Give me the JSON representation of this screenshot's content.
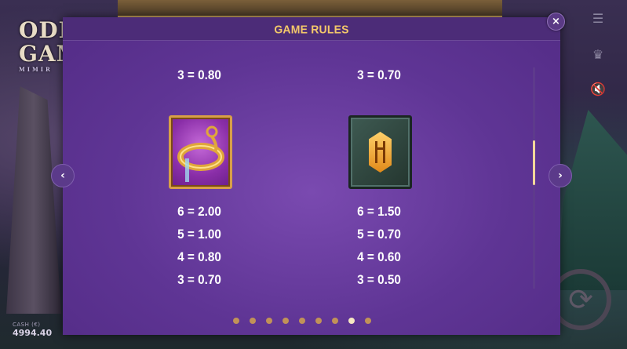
{
  "background": {
    "logo_line1": "ODI",
    "logo_line2": "GAM",
    "logo_sub": "MIMIR",
    "cash_label": "CASH (€)",
    "cash_value": "4994.40",
    "icons": [
      "menu-icon",
      "trophy-icon",
      "sound-off-icon",
      "spin-icon"
    ]
  },
  "modal": {
    "title": "GAME RULES",
    "close_label": "×",
    "prev_label": "‹",
    "next_label": "›",
    "left_column": {
      "top_payout": "3 = 0.80",
      "symbol": "bracelet-symbol",
      "payouts": [
        "6 = 2.00",
        "5 = 1.00",
        "4 = 0.80",
        "3 = 0.70"
      ]
    },
    "right_column": {
      "top_payout": "3 = 0.70",
      "symbol": "rune-stone-symbol",
      "payouts": [
        "6 = 1.50",
        "5 = 0.70",
        "4 = 0.60",
        "3 = 0.50"
      ]
    },
    "pagination": {
      "total_pages": 9,
      "active_index": 7
    },
    "colors": {
      "title": "#f3c86a",
      "panel": "#5f3595",
      "active_dot": "#f6e8c2",
      "dot": "#d2a24e"
    }
  }
}
